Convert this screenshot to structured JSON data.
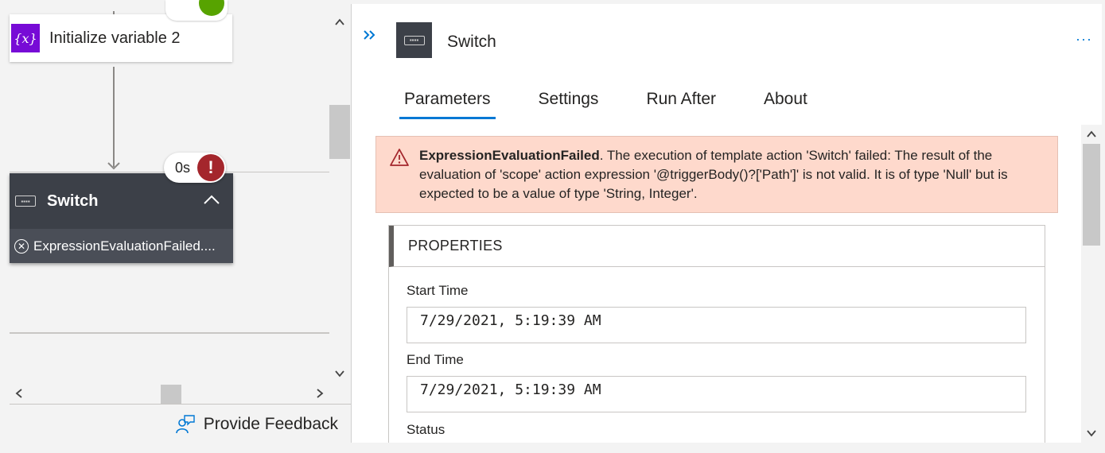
{
  "canvas": {
    "init_card": {
      "title": "Initialize variable 2",
      "icon": "variable-icon"
    },
    "switch_card": {
      "title": "Switch",
      "duration": "0s",
      "status_icon": "error-icon",
      "error_text": "ExpressionEvaluationFailed...."
    },
    "feedback": {
      "label": "Provide Feedback"
    }
  },
  "panel": {
    "title": "Switch",
    "more_label": "···",
    "tabs": [
      {
        "label": "Parameters",
        "active": true
      },
      {
        "label": "Settings",
        "active": false
      },
      {
        "label": "Run After",
        "active": false
      },
      {
        "label": "About",
        "active": false
      }
    ],
    "error": {
      "code": "ExpressionEvaluationFailed",
      "message": ". The execution of template action 'Switch' failed: The result of the evaluation of 'scope' action expression '@triggerBody()?['Path']' is not valid. It is of type 'Null' but is expected to be a value of type 'String, Integer'."
    },
    "properties": {
      "header": "PROPERTIES",
      "start_time_label": "Start Time",
      "start_time_value": "7/29/2021, 5:19:39 AM",
      "end_time_label": "End Time",
      "end_time_value": "7/29/2021, 5:19:39 AM",
      "status_label": "Status"
    }
  },
  "colors": {
    "accent": "#0078d4",
    "variable_icon_bg": "#770bd6",
    "success": "#57a300",
    "error": "#a4262c",
    "error_bg": "#fed9cc",
    "switch_card_bg": "#3c4048"
  }
}
